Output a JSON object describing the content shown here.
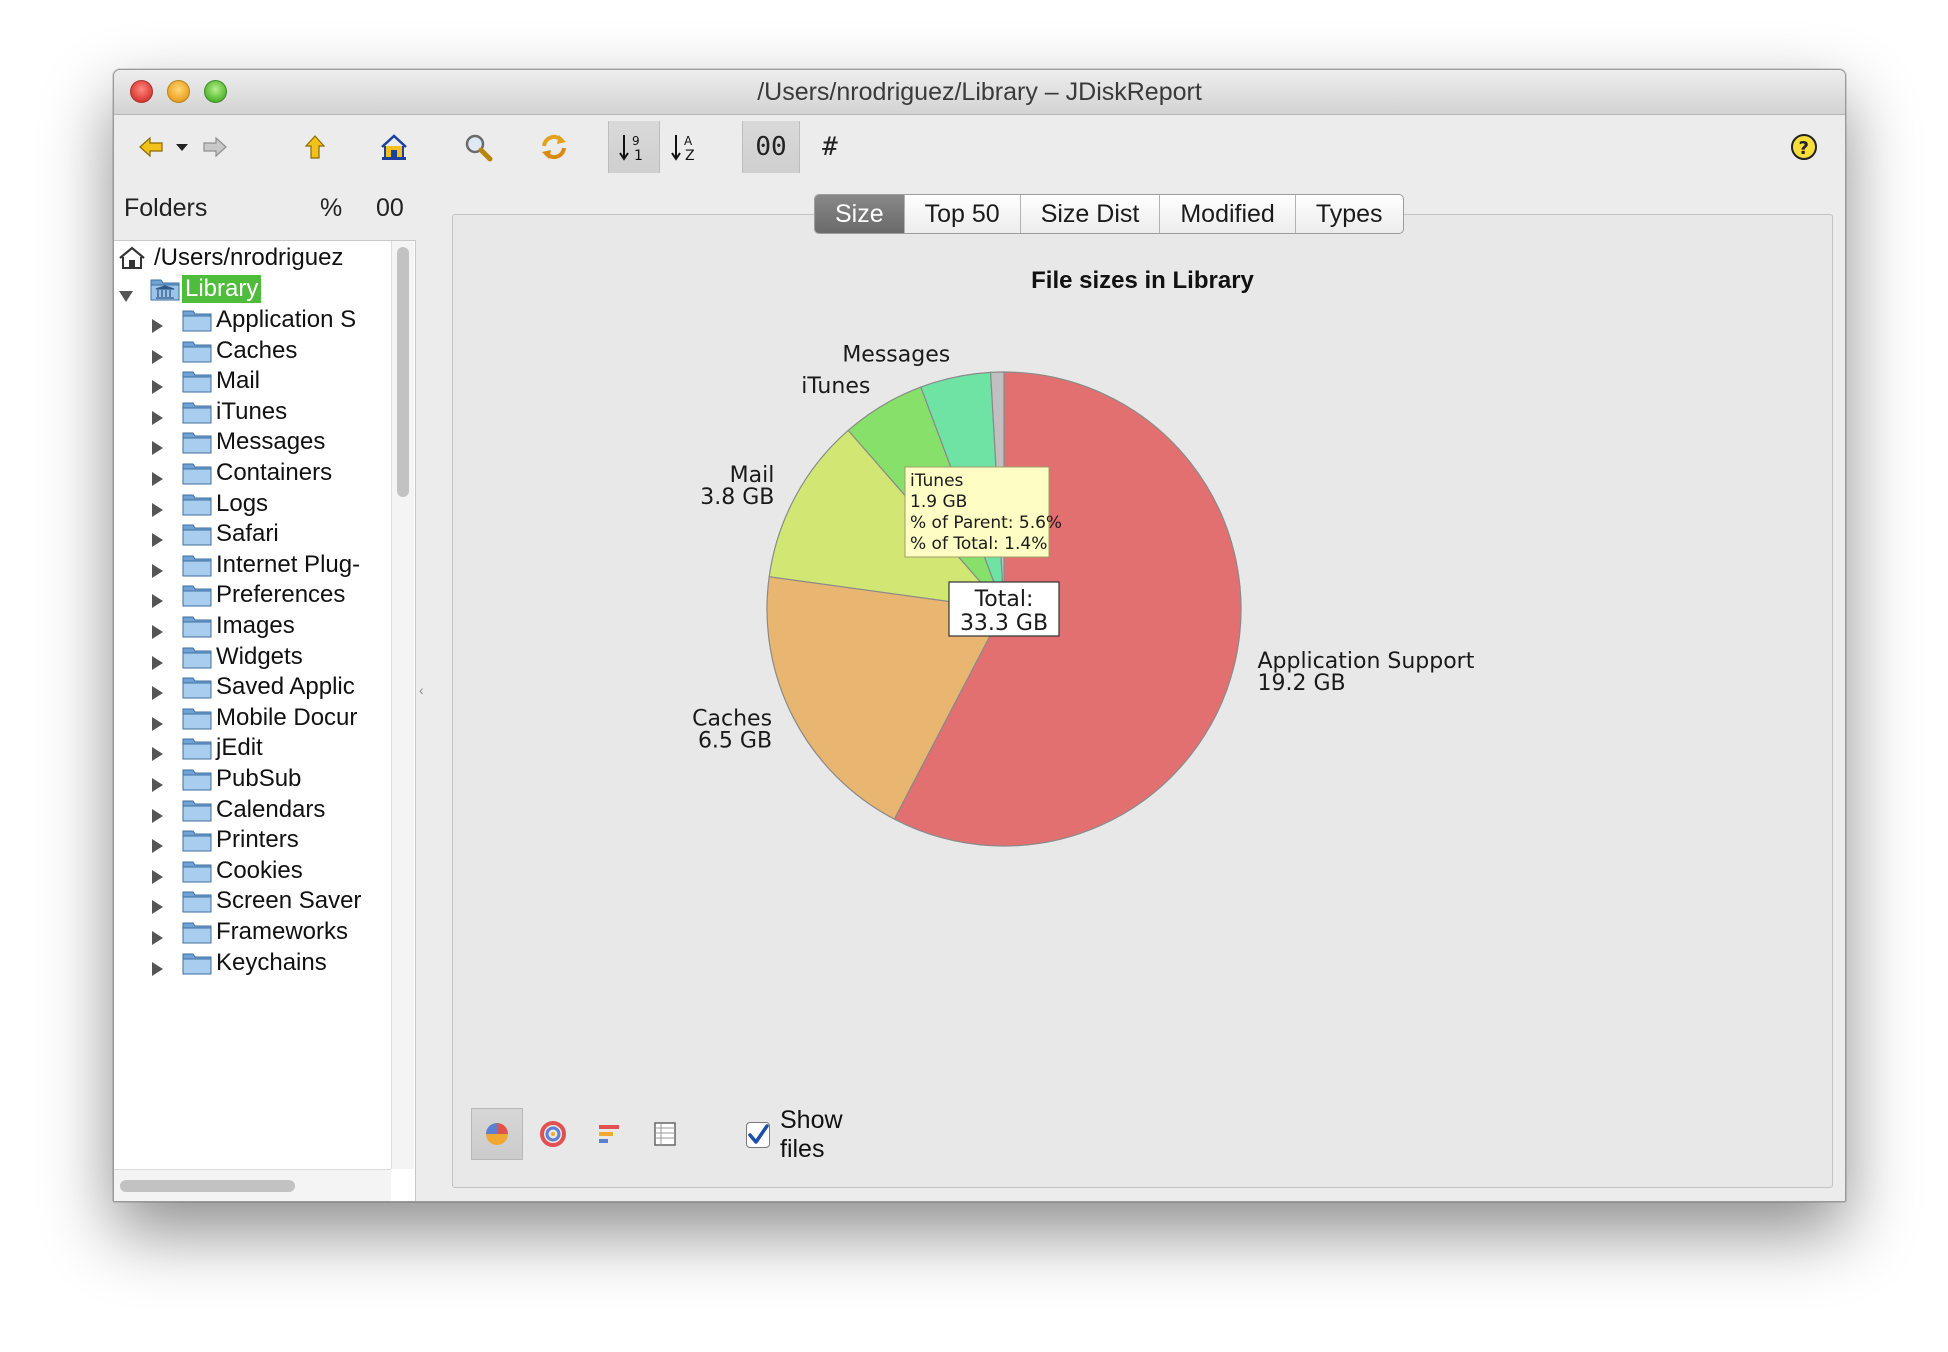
{
  "window": {
    "title": "/Users/nrodriguez/Library – JDiskReport"
  },
  "toolbar": {
    "buttons": [
      "back-icon",
      "history-dropdown-icon",
      "forward-icon",
      "up-icon",
      "home-icon",
      "search-icon",
      "refresh-icon",
      "sort-by-size-icon",
      "sort-by-name-icon"
    ],
    "size_units_label": "00",
    "count_label": "#"
  },
  "folders": {
    "header": {
      "title": "Folders",
      "percent": "%",
      "size": "00"
    },
    "root": "/Users/nrodriguez",
    "selected": "Library",
    "items": [
      "Application S",
      "Caches",
      "Mail",
      "iTunes",
      "Messages",
      "Containers",
      "Logs",
      "Safari",
      "Internet Plug-",
      "Preferences",
      "Images",
      "Widgets",
      "Saved Applic",
      "Mobile Docur",
      "jEdit",
      "PubSub",
      "Calendars",
      "Printers",
      "Cookies",
      "Screen Saver",
      "Frameworks",
      "Keychains"
    ]
  },
  "tabs": [
    "Size",
    "Top 50",
    "Size Dist",
    "Modified",
    "Types"
  ],
  "active_tab": "Size",
  "chart_data": {
    "type": "pie",
    "title": "File sizes in Library",
    "total_label": "Total:",
    "total_value": "33.3 GB",
    "slices": [
      {
        "name": "Application Support",
        "value_label": "19.2 GB",
        "value": 19.2,
        "color": "#e37070"
      },
      {
        "name": "Caches",
        "value_label": "6.5 GB",
        "value": 6.5,
        "color": "#e8b671"
      },
      {
        "name": "Mail",
        "value_label": "3.8 GB",
        "value": 3.8,
        "color": "#d2e673"
      },
      {
        "name": "iTunes",
        "value_label": "",
        "value": 1.9,
        "color": "#87e06a"
      },
      {
        "name": "Messages",
        "value_label": "",
        "value": 1.6,
        "color": "#6fe3a4"
      },
      {
        "name": "",
        "value_label": "",
        "value": 0.3,
        "color": "#c0c0c0"
      }
    ],
    "tooltip": {
      "name": "iTunes",
      "size": "1.9 GB",
      "parent_pct": "% of Parent: 5.6%",
      "total_pct": "% of Total: 1.4%"
    }
  },
  "bottom": {
    "view_buttons": [
      "pie-chart-icon",
      "ring-chart-icon",
      "bar-chart-icon",
      "table-icon"
    ],
    "show_files_label": "Show files",
    "show_files_checked": true
  }
}
